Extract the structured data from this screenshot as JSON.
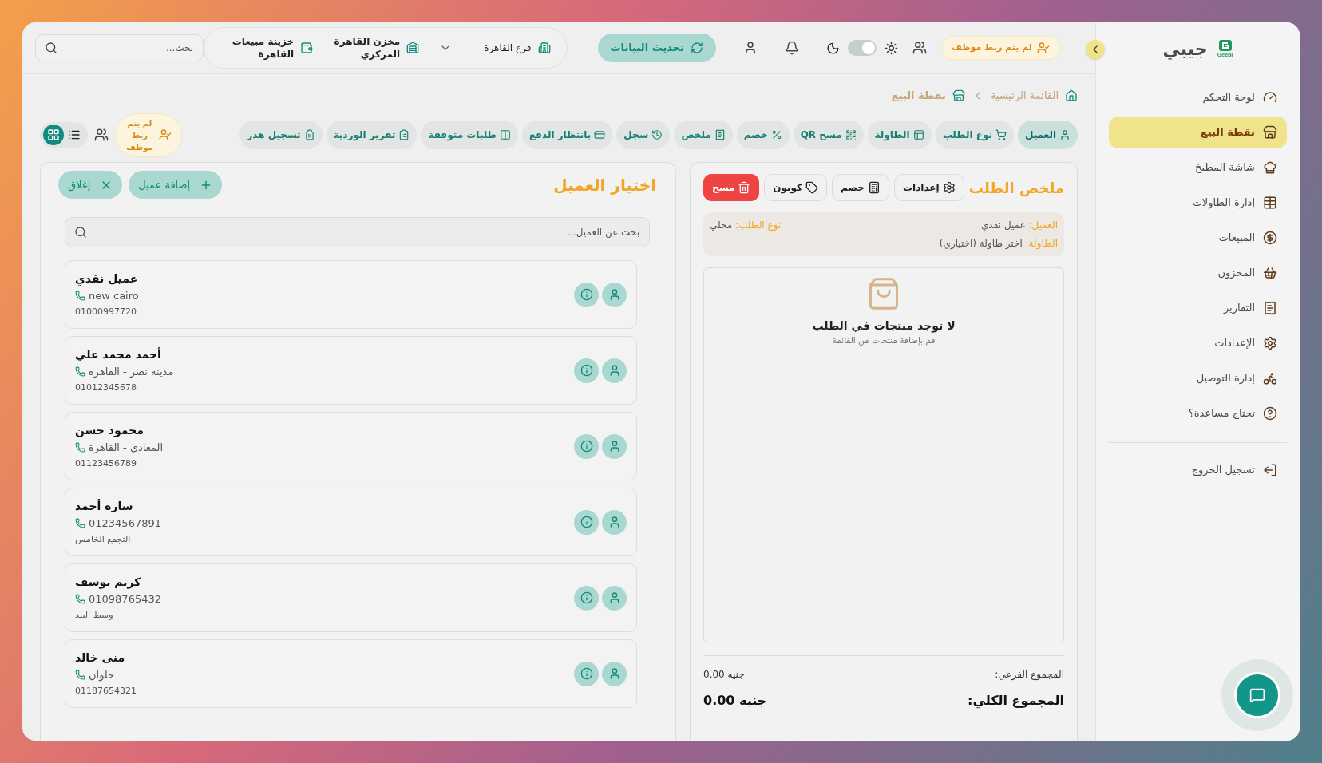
{
  "sidebar": {
    "logo_mark": "Geebi",
    "brand": "جيبي",
    "items": [
      {
        "label": "لوحة التحكم",
        "selected": false
      },
      {
        "label": "نقطة البيع",
        "selected": true
      },
      {
        "label": "شاشة المطبخ",
        "selected": false
      },
      {
        "label": "إدارة الطاولات",
        "selected": false
      },
      {
        "label": "المبيعات",
        "selected": false
      },
      {
        "label": "المخزون",
        "selected": false
      },
      {
        "label": "التقارير",
        "selected": false
      },
      {
        "label": "الإعدادات",
        "selected": false
      },
      {
        "label": "إدارة التوصيل",
        "selected": false
      },
      {
        "label": "تحتاج مساعدة؟",
        "selected": false
      }
    ],
    "logout": "تسجيل الخروج"
  },
  "top_bar": {
    "employee_badge": "لم يتم ربط موظف",
    "light_mode": true,
    "refresh_button": "تحديث البيانات",
    "branch": "فرع القاهرة",
    "warehouse": "مخزن القاهرة المركزي",
    "treasury": "خزينة مبيعات القاهرة",
    "search": {
      "placeholder": "بحث..."
    }
  },
  "breadcrumb": [
    "القائمة الرئيسية",
    "نقطة البيع"
  ],
  "toolbar": {
    "items": [
      {
        "label": "العميل",
        "selected": true
      },
      {
        "label": "نوع الطلب",
        "selected": false
      },
      {
        "label": "الطاولة",
        "selected": false
      },
      {
        "label": "مسح QR",
        "selected": false
      },
      {
        "label": "خصم",
        "selected": false
      },
      {
        "label": "ملخص",
        "selected": false
      },
      {
        "label": "سجل",
        "selected": false
      },
      {
        "label": "بانتظار الدفع",
        "selected": false
      },
      {
        "label": "طلبات متوقفة",
        "selected": false
      },
      {
        "label": "تقرير الوردية",
        "selected": false
      },
      {
        "label": "تسجيل هدر",
        "selected": false
      }
    ],
    "employee_badge": "لم يتم ربط موظف",
    "views": [
      {
        "selected": false
      },
      {
        "selected": true
      }
    ]
  },
  "order_summary": {
    "title": "ملخص الطلب",
    "actions": [
      {
        "label": "إعدادات",
        "kind": "default"
      },
      {
        "label": "خصم",
        "kind": "default"
      },
      {
        "label": "كوبون",
        "kind": "default"
      },
      {
        "label": "مسح",
        "kind": "danger"
      }
    ],
    "customer": {
      "label": "العميل:",
      "value": "عميل نقدي"
    },
    "order_type": {
      "label": "نوع الطلب:",
      "value": "محلي"
    },
    "table": {
      "label": "الطاولة:",
      "value": "اختر طاولة (اختياري)"
    },
    "empty": {
      "title": "لا توجد منتجات في الطلب",
      "hint": "قم بإضافة منتجات من القائمة"
    },
    "subtotal": {
      "label": "المجموع الفرعي:",
      "value": "0.00 جنيه"
    },
    "total": {
      "label": "المجموع الكلي:",
      "value": "0.00 جنيه"
    }
  },
  "customer_panel": {
    "title": "اختيار العميل",
    "add_button": "إضافة عميل",
    "close_button": "إغلاق",
    "search": {
      "placeholder": "بحث عن العميل..."
    },
    "customers": [
      {
        "name": "عميل نقدي",
        "primary": "new cairo",
        "secondary": "01000997720"
      },
      {
        "name": "أحمد محمد علي",
        "primary": "مدينة نصر - القاهرة",
        "secondary": "01012345678"
      },
      {
        "name": "محمود حسن",
        "primary": "المعادي - القاهرة",
        "secondary": "01123456789"
      },
      {
        "name": "سارة أحمد",
        "primary": "01234567891",
        "secondary": "التجمع الخامس"
      },
      {
        "name": "كريم يوسف",
        "primary": "01098765432",
        "secondary": "وسط البلد"
      },
      {
        "name": "منى خالد",
        "primary": "حلوان",
        "secondary": "01187654321"
      }
    ]
  }
}
